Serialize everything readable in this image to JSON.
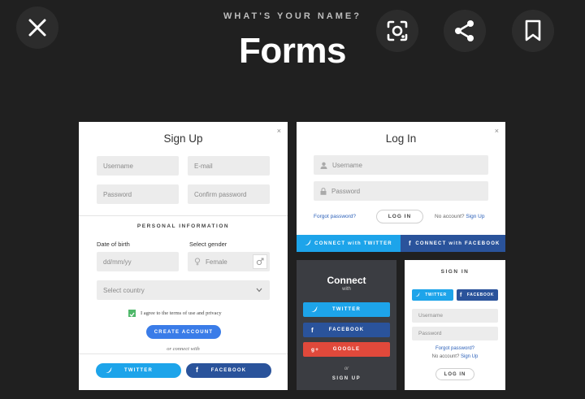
{
  "header": {
    "subtitle": "WHAT'S YOUR NAME?",
    "title": "Forms"
  },
  "viewer": {
    "close_icon": "close-icon",
    "lens_icon": "google-lens-icon",
    "share_icon": "share-icon",
    "bookmark_icon": "bookmark-icon"
  },
  "signup": {
    "title": "Sign Up",
    "close": "×",
    "username_placeholder": "Username",
    "email_placeholder": "E-mail",
    "password_placeholder": "Password",
    "confirm_placeholder": "Confirm password",
    "section_label": "PERSONAL INFORMATION",
    "dob_label": "Date of birth",
    "dob_placeholder": "dd/mm/yy",
    "gender_label": "Select gender",
    "gender_value": "Female",
    "country_placeholder": "Select country",
    "terms_label": "I agree to the terms of use and privacy",
    "create_button": "CREATE ACCOUNT",
    "or_connect": "or connect with",
    "twitter_button": "TWITTER",
    "facebook_button": "FACEBOOK"
  },
  "login": {
    "title": "Log In",
    "close": "×",
    "username_placeholder": "Username",
    "password_placeholder": "Password",
    "forgot_link": "Forgot password?",
    "login_button": "LOG IN",
    "no_account": "No account?",
    "signup_link": "Sign Up",
    "twitter_button": "CONNECT with TWITTER",
    "facebook_button": "CONNECT with FACEBOOK"
  },
  "connect": {
    "title": "Connect",
    "with": "with",
    "twitter_button": "TWITTER",
    "facebook_button": "FACEBOOK",
    "google_button": "GOOGLE",
    "google_icon_text": "g+",
    "or": "or",
    "signup_button": "SIGN UP"
  },
  "signin": {
    "title": "SIGN IN",
    "twitter_button": "TWITTER",
    "facebook_button": "FACEBOOK",
    "username_placeholder": "Username",
    "password_placeholder": "Password",
    "forgot_link": "Forgot password?",
    "no_account": "No account?",
    "signup_link": "Sign Up",
    "login_button": "LOG IN"
  },
  "colors": {
    "background": "#202020",
    "primary_blue": "#3a7ce8",
    "twitter": "#1da4ea",
    "facebook": "#2a539b",
    "google": "#e0493b",
    "dark_card": "#3b3d42"
  }
}
